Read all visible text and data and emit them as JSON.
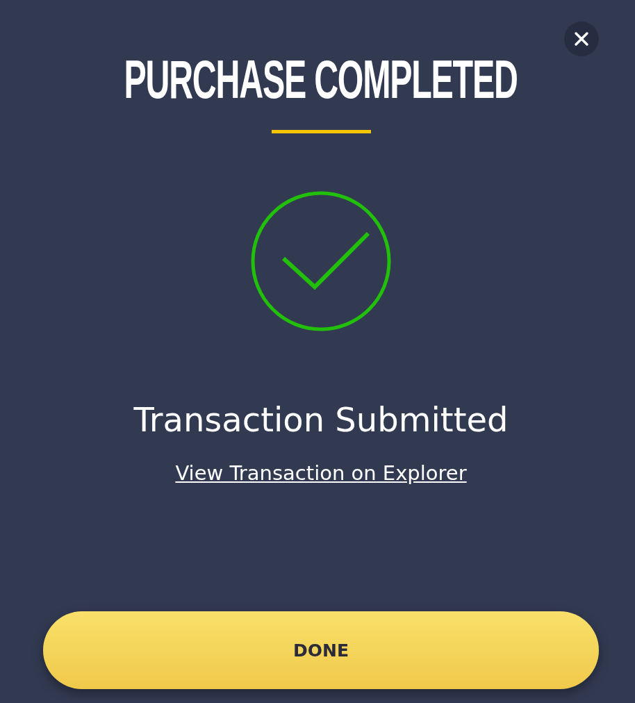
{
  "dialog": {
    "title": "PURCHASE COMPLETED",
    "status": "Transaction Submitted",
    "link": "View Transaction on Explorer",
    "button": "DONE"
  }
}
